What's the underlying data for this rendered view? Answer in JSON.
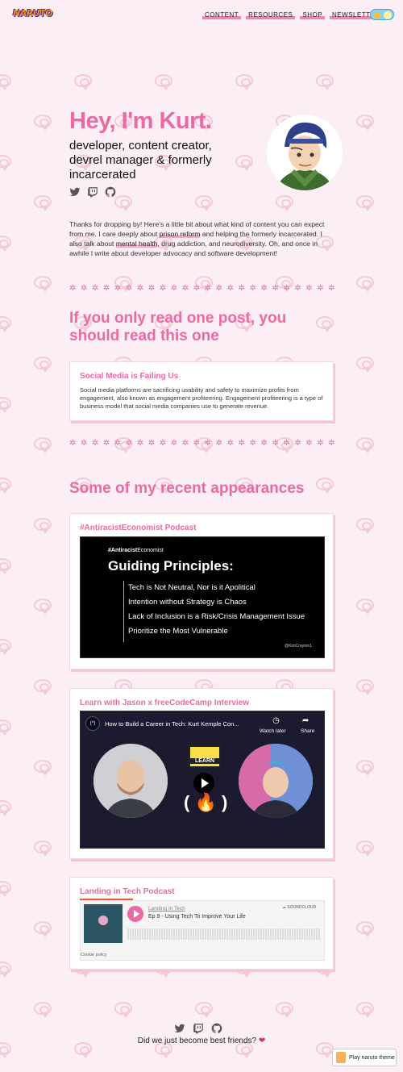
{
  "site": {
    "logo_text": "NARUTO"
  },
  "nav": {
    "items": [
      "CONTENT",
      "RESOURCES",
      "SHOP",
      "NEWSLETTER"
    ]
  },
  "hero": {
    "title": "Hey, I'm Kurt.",
    "subtitle": "developer, content creator, devrel manager & formerly incarcerated"
  },
  "intro": {
    "part1": "Thanks for dropping by! Here's a little bit about what kind of content you can expect from me. I care deeply about ",
    "link1": "prison reform",
    "part2": " and helping the formerly incarcerated. I also talk about ",
    "link2": "mental health",
    "part3": ", drug addiction, and neurodiversity. Oh, and once in awhile I write about developer advocacy and software development!"
  },
  "sections": {
    "read_one": "If you only read one post, you should read this one",
    "appearances": "Some of my recent appearances"
  },
  "featured_post": {
    "title": "Social Media is Failing Us",
    "body": "Social media platforms are sacrificing usability and safety to maximize profits from engagement, also known as engagement profiteering. Engagement profiteering is a type of business model that social media companies use to generate revenue."
  },
  "appearances": [
    {
      "title": "#AntiracistEconomist Podcast",
      "slide": {
        "brand_bold": "#Antiracist",
        "brand_rest": "Economist",
        "heading": "Guiding Principles:",
        "items": [
          "Tech is Not Neutral, Nor is it Apolitical",
          "Intention without Strategy is Chaos",
          "Lack of Inclusion is a Risk/Crisis Management Issue",
          "Prioritize the Most Vulnerable"
        ],
        "handle": "@KimCrayton1"
      }
    },
    {
      "title": "Learn with Jason x freeCodeCamp Interview",
      "video": {
        "title": "How to Build a Career in Tech: Kurt Kemple Con...",
        "watch_later": "Watch later",
        "share": "Share",
        "badge": "LEARN"
      }
    },
    {
      "title": "Landing in Tech Podcast",
      "player": {
        "show": "Landing In Tech",
        "episode": "Ep 9 - Using Tech To Improve Your Life",
        "brand": "SOUNDCLOUD",
        "cookie": "Cookie policy"
      }
    }
  ],
  "footer": {
    "text": "Did we just become best friends?"
  },
  "theme_button": {
    "label": "Play naruto theme"
  },
  "colors": {
    "accent": "#ec6aa3",
    "background": "#fbeef4"
  }
}
